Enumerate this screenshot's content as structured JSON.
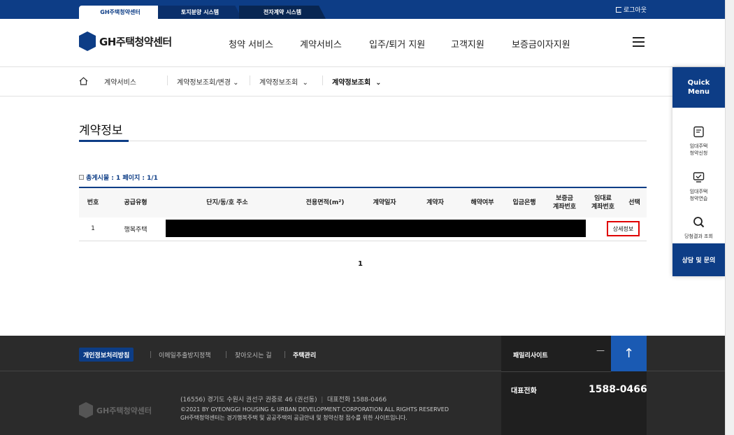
{
  "top_tabs": [
    "GH주택청약센터",
    "토지분양 시스템",
    "전자계약 시스템"
  ],
  "logout_label": "로그아웃",
  "logo_text": "GH주택청약센터",
  "nav": [
    "청약 서비스",
    "계약서비스",
    "입주/퇴거 지원",
    "고객지원",
    "보증금이자지원"
  ],
  "breadcrumb": {
    "level1": "계약서비스",
    "level2": "계약정보조회/변경",
    "level3": "계약정보조회",
    "level4": "계약정보조회"
  },
  "page_title": "계약정보",
  "count_text": "총게시물 : 1 페이지 : 1/1",
  "table": {
    "headers": [
      "번호",
      "공급유형",
      "단지/동/호 주소",
      "전용면적(m²)",
      "계약일자",
      "계약자",
      "해약여부",
      "입금은행",
      "보증금\n계좌번호",
      "임대료\n계좌번호",
      "선택"
    ],
    "rows": [
      {
        "no": "1",
        "type": "행복주택",
        "button": "상세정보"
      }
    ]
  },
  "pagination": "1",
  "quick_menu": {
    "title": "Quick\nMenu",
    "items": [
      {
        "label": "임대주택\n청약신청",
        "icon": "document-edit-icon"
      },
      {
        "label": "임대주택\n청약연습",
        "icon": "monitor-check-icon"
      },
      {
        "label": "당첨결과 조회",
        "icon": "search-icon"
      }
    ],
    "footer": "상담 및 문의"
  },
  "footer": {
    "privacy": "개인정보처리방침",
    "links": [
      "이메일추출방지정책",
      "찾아오시는 길",
      "주택관리"
    ],
    "family_site": "패밀리사이트",
    "rep_phone_label": "대표전화",
    "rep_phone": "1588-0466",
    "logo_text": "GH주택청약센터",
    "address": "(16556) 경기도 수원시 권선구 권중로 46 (권선동)",
    "tel_text": "대표전화 1588-0466",
    "copyright": "©2021 BY GYEONGGI HOUSING & URBAN DEVELOPMENT CORPORATION ALL RIGHTS RESERVED",
    "description": "GH주택청약센터는 경기행복주택 및 공공주택의 공급안내 및 청약신청 접수를 위한 사이트입니다."
  },
  "colors": {
    "brand": "#0d3d86",
    "highlight": "#e00000"
  }
}
